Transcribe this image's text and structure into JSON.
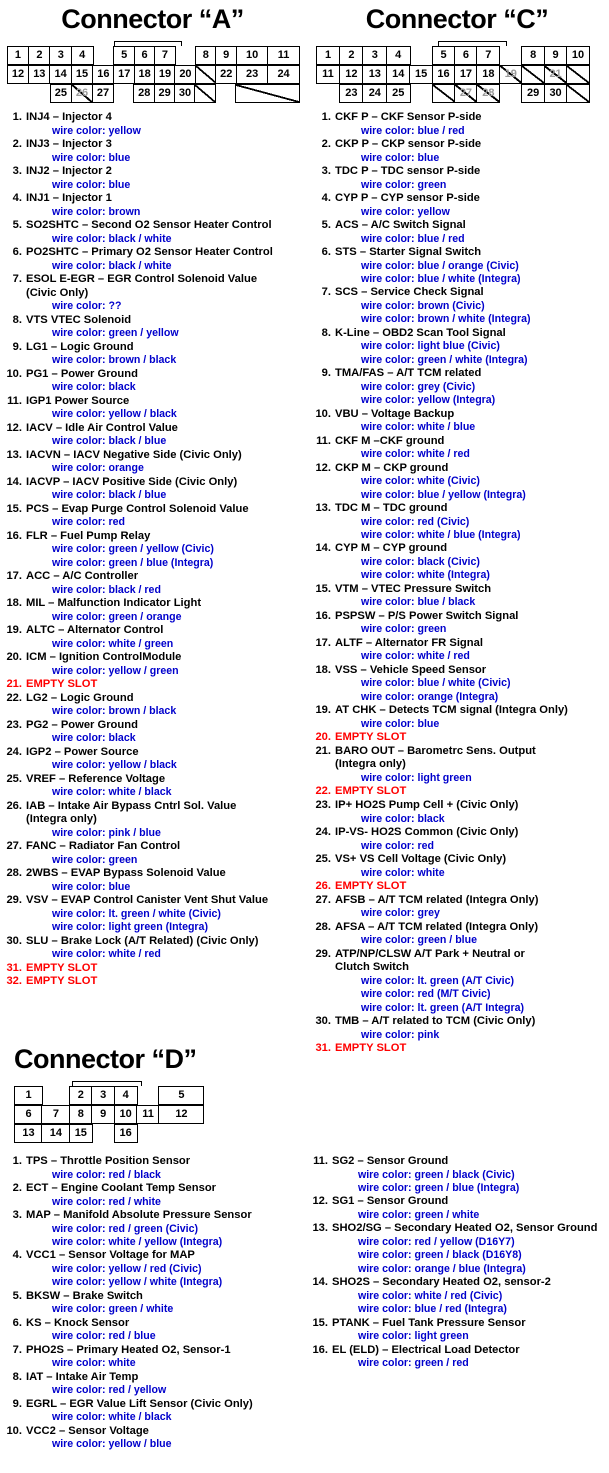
{
  "connectors": [
    {
      "id": "A",
      "title": "Connector “A”",
      "grid": {
        "rows": [
          [
            "1",
            "2",
            "3",
            "4",
            "",
            "5",
            "6",
            "7",
            "",
            "8",
            "9",
            "10",
            "11"
          ],
          [
            "12",
            "13",
            "14",
            "15",
            "16",
            "17",
            "18",
            "19",
            "20",
            "",
            "22",
            "23",
            "24"
          ],
          [
            "",
            "25",
            "26",
            "27",
            "",
            "28",
            "29",
            "30",
            "",
            "",
            ""
          ]
        ]
      },
      "pins": [
        {
          "n": "1",
          "name": "INJ4 – Injector 4",
          "wires": [
            "wire color: yellow"
          ]
        },
        {
          "n": "2",
          "name": "INJ3 – Injector 3",
          "wires": [
            "wire color: blue"
          ]
        },
        {
          "n": "3",
          "name": "INJ2 – Injector 2",
          "wires": [
            "wire color: blue"
          ]
        },
        {
          "n": "4",
          "name": "INJ1 – Injector 1",
          "wires": [
            "wire color: brown"
          ]
        },
        {
          "n": "5",
          "name": "SO2SHTC – Second O2 Sensor Heater Control",
          "wires": [
            "wire color: black / white"
          ]
        },
        {
          "n": "6",
          "name": "PO2SHTC – Primary O2 Sensor Heater Control",
          "wires": [
            "wire color: black / white"
          ]
        },
        {
          "n": "7",
          "name": "ESOL E-EGR – EGR Control Solenoid Value",
          "name2": "(Civic Only)",
          "wires": [
            "wire color: ??"
          ]
        },
        {
          "n": "8",
          "name": "VTS VTEC Solenoid",
          "wires": [
            "wire color: green / yellow"
          ]
        },
        {
          "n": "9",
          "name": "LG1 – Logic Ground",
          "wires": [
            "wire color: brown / black"
          ]
        },
        {
          "n": "10",
          "name": "PG1 – Power Ground",
          "wires": [
            "wire color: black"
          ]
        },
        {
          "n": "11",
          "name": "IGP1 Power Source",
          "wires": [
            "wire color: yellow / black"
          ]
        },
        {
          "n": "12",
          "name": "IACV – Idle Air Control Value",
          "wires": [
            "wire color: black / blue"
          ]
        },
        {
          "n": "13",
          "name": "IACVN – IACV Negative Side (Civic Only)",
          "wires": [
            "wire color: orange"
          ]
        },
        {
          "n": "14",
          "name": "IACVP – IACV Positive Side (Civic Only)",
          "wires": [
            "wire color: black / blue"
          ]
        },
        {
          "n": "15",
          "name": "PCS – Evap Purge Control Solenoid Value",
          "wires": [
            "wire color: red"
          ]
        },
        {
          "n": "16",
          "name": "FLR – Fuel Pump Relay",
          "wires": [
            "wire color: green / yellow (Civic)",
            "wire color: green / blue (Integra)"
          ]
        },
        {
          "n": "17",
          "name": "ACC – A/C Controller",
          "wires": [
            "wire color: black / red"
          ]
        },
        {
          "n": "18",
          "name": "MIL – Malfunction Indicator Light",
          "wires": [
            "wire color: green / orange"
          ]
        },
        {
          "n": "19",
          "name": "ALTC – Alternator Control",
          "wires": [
            "wire color: white / green"
          ]
        },
        {
          "n": "20",
          "name": "ICM – Ignition ControlModule",
          "wires": [
            "wire color: yellow / green"
          ]
        },
        {
          "n": "21",
          "name": "EMPTY SLOT",
          "empty": true,
          "wires": []
        },
        {
          "n": "22",
          "name": "LG2 – Logic Ground",
          "wires": [
            "wire color: brown / black"
          ]
        },
        {
          "n": "23",
          "name": "PG2 – Power Ground",
          "wires": [
            "wire color: black"
          ]
        },
        {
          "n": "24",
          "name": "IGP2 – Power Source",
          "wires": [
            "wire color: yellow / black"
          ]
        },
        {
          "n": "25",
          "name": "VREF – Reference Voltage",
          "wires": [
            "wire color: white / black"
          ]
        },
        {
          "n": "26",
          "name": "IAB – Intake Air Bypass Cntrl Sol. Value",
          "name2": "(Integra only)",
          "wires": [
            "wire color: pink / blue"
          ]
        },
        {
          "n": "27",
          "name": "FANC – Radiator Fan Control",
          "wires": [
            "wire color: green"
          ]
        },
        {
          "n": "28",
          "name": "2WBS – EVAP Bypass Solenoid Value",
          "wires": [
            "wire color: blue"
          ]
        },
        {
          "n": "29",
          "name": "VSV – EVAP Control Canister Vent Shut Value",
          "wires": [
            "wire color: lt. green / white (Civic)",
            "wire color: light green (Integra)"
          ]
        },
        {
          "n": "30",
          "name": "SLU – Brake Lock (A/T Related) (Civic Only)",
          "wires": [
            "wire color: white / red"
          ]
        },
        {
          "n": "31",
          "name": "EMPTY SLOT",
          "empty": true,
          "wires": []
        },
        {
          "n": "32",
          "name": "EMPTY SLOT",
          "empty": true,
          "wires": []
        }
      ]
    },
    {
      "id": "C",
      "title": "Connector “C”",
      "grid": {
        "rows": [
          [
            "1",
            "2",
            "3",
            "4",
            "",
            "5",
            "6",
            "7",
            "",
            "8",
            "9",
            "10"
          ],
          [
            "11",
            "12",
            "13",
            "14",
            "15",
            "16",
            "17",
            "18",
            "19",
            "",
            "21",
            ""
          ],
          [
            "",
            "23",
            "24",
            "25",
            "",
            "",
            "27",
            "28",
            "",
            "29",
            "30",
            ""
          ]
        ]
      },
      "pins": [
        {
          "n": "1",
          "name": "CKF P – CKF Sensor P-side",
          "wires": [
            "wire color: blue / red"
          ]
        },
        {
          "n": "2",
          "name": "CKP P – CKP sensor P-side",
          "wires": [
            "wire color: blue"
          ]
        },
        {
          "n": "3",
          "name": "TDC P – TDC sensor P-side",
          "wires": [
            "wire color: green"
          ]
        },
        {
          "n": "4",
          "name": "CYP P – CYP sensor P-side",
          "wires": [
            "wire color: yellow"
          ]
        },
        {
          "n": "5",
          "name": "ACS – A/C Switch Signal",
          "wires": [
            "wire color: blue / red"
          ]
        },
        {
          "n": "6",
          "name": "STS – Starter Signal Switch",
          "wires": [
            "wire color: blue / orange (Civic)",
            "wire color: blue / white (Integra)"
          ]
        },
        {
          "n": "7",
          "name": "SCS – Service Check Signal",
          "wires": [
            "wire color: brown (Civic)",
            "wire color: brown / white (Integra)"
          ]
        },
        {
          "n": "8",
          "name": "K-Line – OBD2 Scan Tool Signal",
          "wires": [
            "wire color: light blue (Civic)",
            "wire color: green / white (Integra)"
          ]
        },
        {
          "n": "9",
          "name": "TMA/FAS – A/T TCM related",
          "wires": [
            "wire color: grey (Civic)",
            "wire color: yellow (Integra)"
          ]
        },
        {
          "n": "10",
          "name": "VBU – Voltage Backup",
          "wires": [
            "wire color: white / blue"
          ]
        },
        {
          "n": "11",
          "name": "CKF M –CKF ground",
          "wires": [
            "wire color: white / red"
          ]
        },
        {
          "n": "12",
          "name": "CKP M – CKP ground",
          "wires": [
            "wire color: white (Civic)",
            "wire color: blue / yellow (Integra)"
          ]
        },
        {
          "n": "13",
          "name": "TDC M – TDC ground",
          "wires": [
            "wire color: red (Civic)",
            "wire color: white / blue (Integra)"
          ]
        },
        {
          "n": "14",
          "name": "CYP M – CYP ground",
          "wires": [
            "wire color: black (Civic)",
            "wire color: white (Integra)"
          ]
        },
        {
          "n": "15",
          "name": "VTM – VTEC Pressure Switch",
          "wires": [
            "wire color: blue / black"
          ]
        },
        {
          "n": "16",
          "name": "PSPSW – P/S Power Switch Signal",
          "wires": [
            "wire color: green"
          ]
        },
        {
          "n": "17",
          "name": "ALTF – Alternator FR Signal",
          "wires": [
            "wire color: white / red"
          ]
        },
        {
          "n": "18",
          "name": "VSS – Vehicle Speed Sensor",
          "wires": [
            "wire color: blue / white (Civic)",
            "wire color: orange (Integra)"
          ]
        },
        {
          "n": "19",
          "name": "AT CHK – Detects TCM signal (Integra Only)",
          "wires": [
            "wire color: blue"
          ]
        },
        {
          "n": "20",
          "name": "EMPTY SLOT",
          "empty": true,
          "wires": []
        },
        {
          "n": "21",
          "name": "BARO OUT – Barometrc Sens. Output",
          "name2": "(Integra only)",
          "wires": [
            "wire color: light green"
          ]
        },
        {
          "n": "22",
          "name": "EMPTY SLOT",
          "empty": true,
          "wires": []
        },
        {
          "n": "23",
          "name": "IP+ HO2S Pump Cell + (Civic Only)",
          "wires": [
            "wire color: black"
          ]
        },
        {
          "n": "24",
          "name": "IP-VS- HO2S Common (Civic Only)",
          "wires": [
            "wire color: red"
          ]
        },
        {
          "n": "25",
          "name": "VS+ VS Cell Voltage (Civic Only)",
          "wires": [
            "wire color: white"
          ]
        },
        {
          "n": "26",
          "name": "EMPTY SLOT",
          "empty": true,
          "wires": []
        },
        {
          "n": "27",
          "name": "AFSB – A/T TCM related (Integra Only)",
          "wires": [
            "wire color: grey"
          ]
        },
        {
          "n": "28",
          "name": "AFSA – A/T TCM related (Integra Only)",
          "wires": [
            "wire color: green / blue"
          ]
        },
        {
          "n": "29",
          "name": "ATP/NP/CLSW A/T Park + Neutral or",
          "name2": "Clutch Switch",
          "wires": [
            "wire color: lt. green (A/T Civic)",
            "wire color: red (M/T Civic)",
            "wire color: lt. green (A/T Integra)"
          ]
        },
        {
          "n": "30",
          "name": "TMB – A/T related to TCM (Civic Only)",
          "wires": [
            "wire color: pink"
          ]
        },
        {
          "n": "31",
          "name": "EMPTY SLOT",
          "empty": true,
          "wires": []
        }
      ]
    },
    {
      "id": "D",
      "title": "Connector “D”",
      "grid": {
        "rows": [
          [
            "1",
            "",
            "2",
            "3",
            "4",
            "",
            "5"
          ],
          [
            "6",
            "7",
            "8",
            "9",
            "10",
            "11",
            "12"
          ],
          [
            "13",
            "14",
            "15",
            "",
            "16",
            "",
            ""
          ]
        ]
      },
      "pins_left": [
        {
          "n": "1",
          "name": "TPS – Throttle Position Sensor",
          "wires": [
            "wire color: red / black"
          ]
        },
        {
          "n": "2",
          "name": "ECT – Engine Coolant Temp Sensor",
          "wires": [
            "wire color: red / white"
          ]
        },
        {
          "n": "3",
          "name": "MAP – Manifold Absolute Pressure Sensor",
          "wires": [
            "wire color: red / green (Civic)",
            "wire color: white / yellow (Integra)"
          ]
        },
        {
          "n": "4",
          "name": "VCC1 – Sensor Voltage for MAP",
          "wires": [
            "wire color: yellow / red (Civic)",
            "wire color: yellow / white (Integra)"
          ]
        },
        {
          "n": "5",
          "name": "BKSW – Brake Switch",
          "wires": [
            "wire color: green / white"
          ]
        },
        {
          "n": "6",
          "name": "KS – Knock Sensor",
          "wires": [
            "wire color: red / blue"
          ]
        },
        {
          "n": "7",
          "name": "PHO2S – Primary Heated O2, Sensor-1",
          "wires": [
            "wire color: white"
          ]
        },
        {
          "n": "8",
          "name": "IAT – Intake Air Temp",
          "wires": [
            "wire color: red / yellow"
          ]
        },
        {
          "n": "9",
          "name": "EGRL – EGR Value Lift Sensor (Civic Only)",
          "wires": [
            "wire color: white / black"
          ]
        },
        {
          "n": "10",
          "name": "VCC2 – Sensor Voltage",
          "wires": [
            "wire color: yellow / blue"
          ]
        }
      ],
      "pins_right": [
        {
          "n": "11",
          "name": "SG2 – Sensor Ground",
          "wires": [
            "wire color: green / black (Civic)",
            "wire color: green / blue (Integra)"
          ]
        },
        {
          "n": "12",
          "name": "SG1 – Sensor Ground",
          "wires": [
            "wire color: green / white"
          ]
        },
        {
          "n": "13",
          "name": "SHO2/SG – Secondary Heated O2, Sensor Ground",
          "wires": [
            "wire color: red / yellow (D16Y7)",
            "wire color: green / black (D16Y8)",
            "wire color: orange / blue (Integra)"
          ]
        },
        {
          "n": "14",
          "name": "SHO2S – Secondary Heated O2, sensor-2",
          "wires": [
            "wire color: white / red (Civic)",
            "wire color: blue / red (Integra)"
          ]
        },
        {
          "n": "15",
          "name": "PTANK – Fuel Tank Pressure Sensor",
          "wires": [
            "wire color: light green"
          ]
        },
        {
          "n": "16",
          "name": "EL (ELD) – Electrical Load Detector",
          "wires": [
            "wire color: green / red"
          ]
        }
      ]
    }
  ],
  "colors": {
    "wire_text": "#0000cc",
    "empty_text": "#ff0000",
    "body_text": "#000000",
    "grayed_pin": "#9a9a9a"
  }
}
